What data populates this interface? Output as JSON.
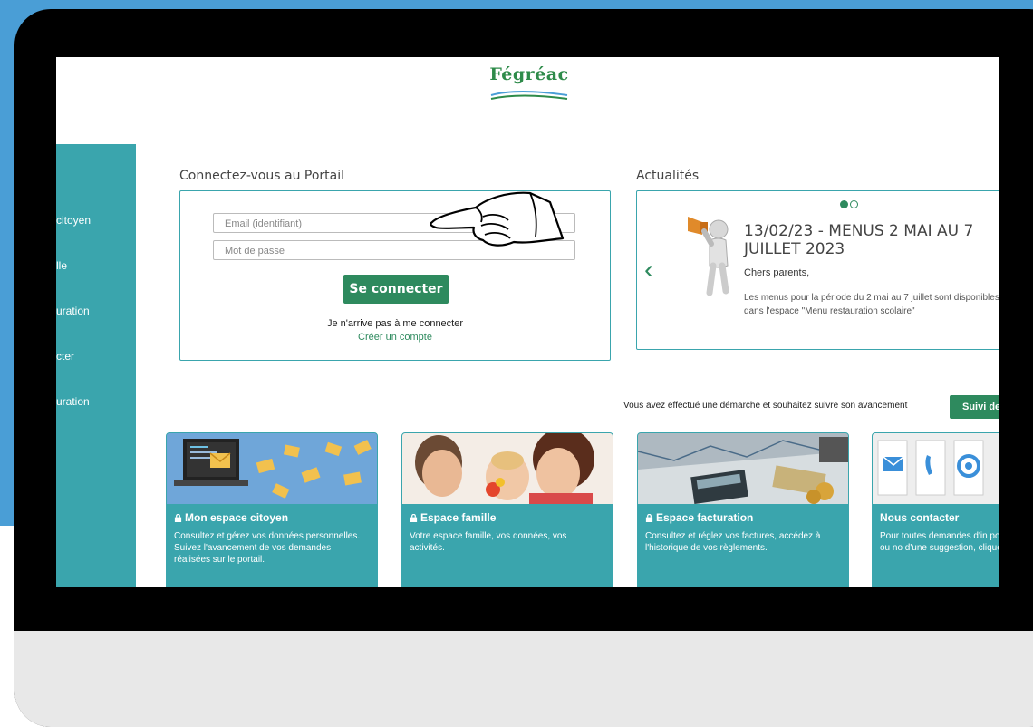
{
  "header": {
    "logo_text": "Fégréac"
  },
  "sidebar": {
    "items": [
      {
        "label": "citoyen"
      },
      {
        "label": "lle"
      },
      {
        "label": "uration"
      },
      {
        "label": "cter"
      },
      {
        "label": "uration"
      }
    ]
  },
  "login": {
    "title": "Connectez-vous au Portail",
    "email_placeholder": "Email (identifiant)",
    "password_placeholder": "Mot de passe",
    "submit_label": "Se connecter",
    "trouble_link": "Je n'arrive pas à me connecter",
    "create_link": "Créer un compte"
  },
  "news": {
    "title": "Actualités",
    "headline": "13/02/23 - MENUS 2 MAI AU 7 JUILLET 2023",
    "greeting": "Chers parents,",
    "body": "Les menus pour la période du 2 mai au 7 juillet sont disponibles dans l'espace \"Menu restauration scolaire\"",
    "more": "v"
  },
  "follow": {
    "text": "Vous avez effectué une démarche et souhaitez suivre son avancement",
    "button_label": "Suivi de"
  },
  "cards": [
    {
      "title": "Mon espace citoyen",
      "desc": "Consultez et gérez vos données personnelles. Suivez l'avancement de vos demandes réalisées sur le portail."
    },
    {
      "title": "Espace famille",
      "desc": "Votre espace famille, vos données, vos activités."
    },
    {
      "title": "Espace facturation",
      "desc": "Consultez et réglez vos factures, accédez à l'historique de vos règlements."
    },
    {
      "title": "Nous contacter",
      "desc": "Pour toutes demandes d'in pour solliciter un élu ou no d'une suggestion, cliquez-"
    }
  ],
  "colors": {
    "teal": "#3aa5ad",
    "green": "#2e8a5e",
    "background_blue": "#4a9ed6"
  }
}
